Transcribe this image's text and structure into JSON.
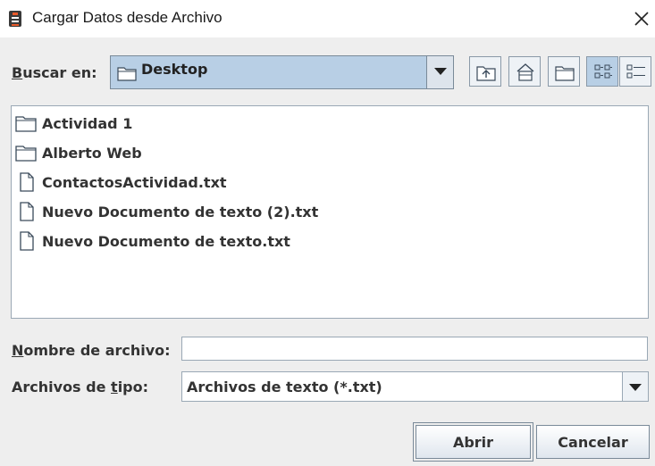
{
  "window": {
    "title": "Cargar Datos desde Archivo"
  },
  "look_in": {
    "label_mnemonic": "B",
    "label_rest": "uscar en:",
    "value": "Desktop",
    "icon": "folder-icon"
  },
  "toolbar": {
    "buttons": [
      {
        "name": "up-one-level-icon",
        "pressed": false
      },
      {
        "name": "home-icon",
        "pressed": false
      },
      {
        "name": "new-folder-icon",
        "pressed": false
      },
      {
        "name": "list-view-icon",
        "pressed": true
      },
      {
        "name": "details-view-icon",
        "pressed": false
      }
    ]
  },
  "files": [
    {
      "name": "Actividad 1",
      "icon": "folder-icon"
    },
    {
      "name": "Alberto Web",
      "icon": "folder-icon"
    },
    {
      "name": "ContactosActividad.txt",
      "icon": "file-icon"
    },
    {
      "name": "Nuevo Documento de texto (2).txt",
      "icon": "file-icon"
    },
    {
      "name": "Nuevo Documento de texto.txt",
      "icon": "file-icon"
    }
  ],
  "filename": {
    "label_mnemonic": "N",
    "label_rest": "ombre de archivo:",
    "value": ""
  },
  "filetype": {
    "label_start": "Archivos de ",
    "label_mnemonic": "t",
    "label_rest": "ipo:",
    "value": "Archivos de texto (*.txt)"
  },
  "buttons": {
    "open": "Abrir",
    "cancel": "Cancelar"
  },
  "colors": {
    "selection": "#b8cfe5",
    "background": "#eeeeee"
  }
}
